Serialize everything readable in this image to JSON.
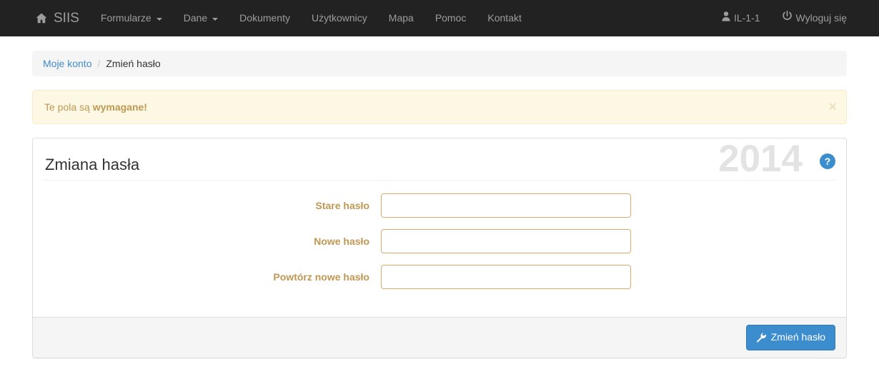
{
  "navbar": {
    "brand": {
      "label": "SIIS",
      "icon": "home-icon"
    },
    "items": [
      {
        "label": "Formularze",
        "caret": true
      },
      {
        "label": "Dane",
        "caret": true
      },
      {
        "label": "Dokumenty",
        "caret": false
      },
      {
        "label": "Użytkownicy",
        "caret": false
      },
      {
        "label": "Mapa",
        "caret": false
      },
      {
        "label": "Pomoc",
        "caret": false
      },
      {
        "label": "Kontakt",
        "caret": false
      }
    ],
    "user": {
      "label": "IL-1-1",
      "icon": "user-icon"
    },
    "logout": {
      "label": "Wyloguj się",
      "icon": "power-icon"
    }
  },
  "breadcrumb": {
    "link_label": "Moje konto",
    "separator": "/",
    "current_label": "Zmień hasło"
  },
  "alert": {
    "text_prefix": "Te pola są ",
    "text_strong": "wymagane!",
    "close_label": "×",
    "background_color": "#fcf8e3",
    "border_color": "#faebcc",
    "text_color": "#c09853"
  },
  "panel": {
    "title": "Zmiana hasła",
    "watermark": "2014",
    "help_label": "?",
    "help_color": "#3c8dcd"
  },
  "form": {
    "fields": [
      {
        "label": "Stare hasło",
        "value": "",
        "placeholder": ""
      },
      {
        "label": "Nowe hasło",
        "value": "",
        "placeholder": ""
      },
      {
        "label": "Powtórz nowe hasło",
        "value": "",
        "placeholder": ""
      }
    ],
    "label_color": "#c09853",
    "input_border_color": "#dbab6c"
  },
  "footer": {
    "submit_label": "Zmień hasło",
    "submit_icon": "wrench-icon",
    "submit_color": "#3c8dcd"
  }
}
